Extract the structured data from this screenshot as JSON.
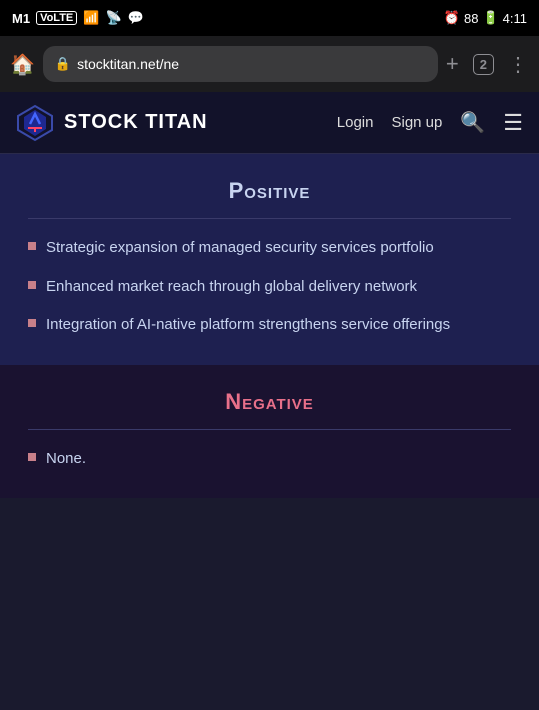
{
  "statusBar": {
    "carrier": "M1",
    "carrierType": "VoLTE",
    "time": "4:11",
    "battery": "88",
    "alarm": true
  },
  "browser": {
    "url": "stocktitan.net/ne",
    "tabCount": "2"
  },
  "nav": {
    "logoText": "STOCK TITAN",
    "loginLabel": "Login",
    "signupLabel": "Sign up"
  },
  "positiveSectionTitle": "Positive",
  "positiveItems": [
    "Strategic expansion of managed security services portfolio",
    "Enhanced market reach through global delivery network",
    "Integration of AI-native platform strengthens service offerings"
  ],
  "negativeSectionTitle": "Negative",
  "negativeItems": [
    "None."
  ]
}
